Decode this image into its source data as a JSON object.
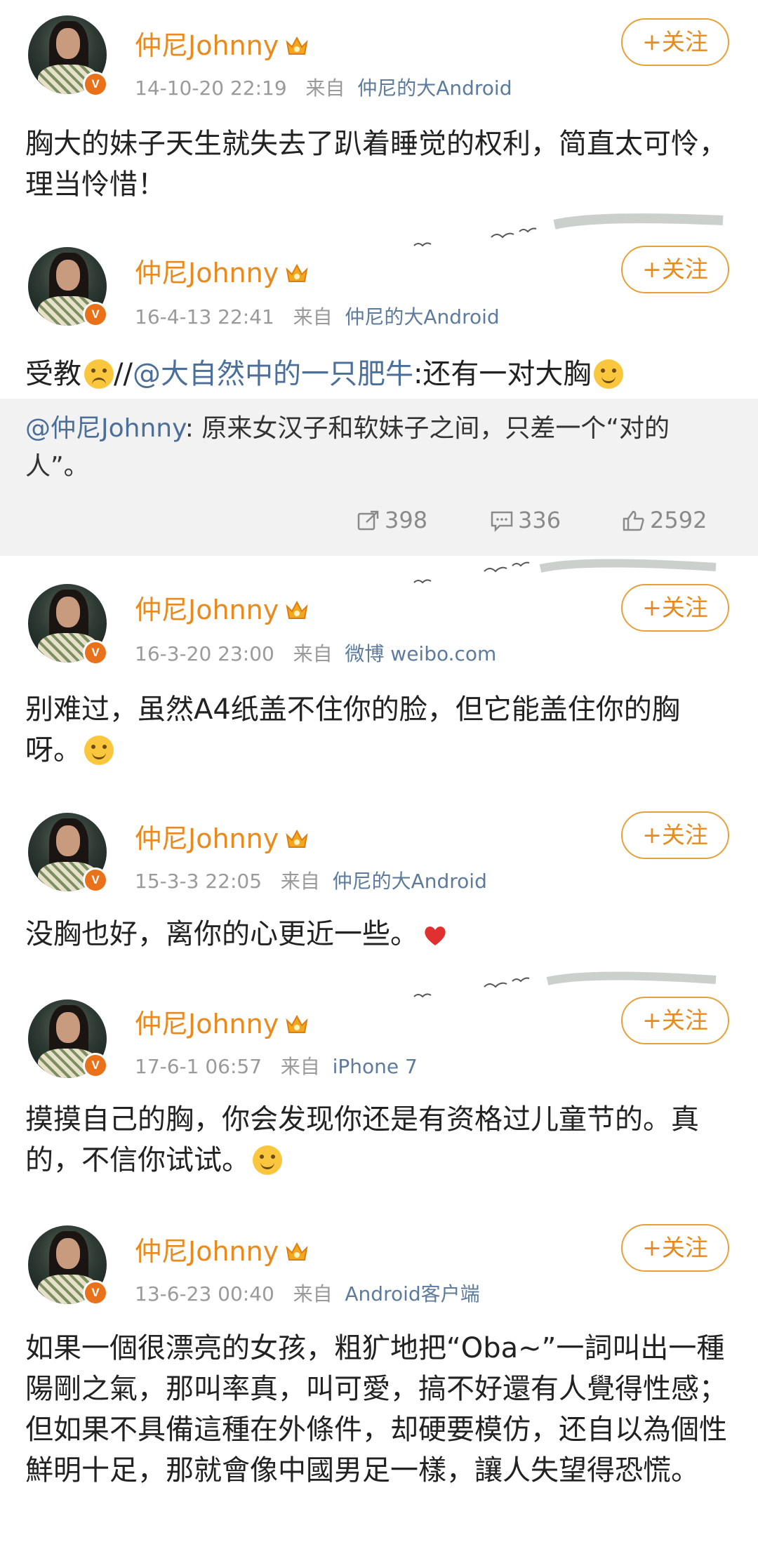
{
  "user": {
    "name": "仲尼Johnny",
    "follow_label": "+关注",
    "avatar_badge": "V"
  },
  "source_prefix": "来自",
  "posts": [
    {
      "time": "14-10-20 22:19",
      "source": "仲尼的大Android",
      "text": "胸大的妹子天生就失去了趴着睡觉的权利，简直太可怜，理当怜惜！"
    },
    {
      "time": "16-4-13 22:41",
      "source": "仲尼的大Android",
      "text_prefix": "受教",
      "text_sep": "//",
      "mention": "@大自然中的一只肥牛",
      "text_suffix": ":还有一对大胸",
      "repost": {
        "mention": "@仲尼Johnny",
        "text": ": 原来女汉子和软妹子之间，只差一个“对的人”。"
      },
      "stats": {
        "reposts": "398",
        "comments": "336",
        "likes": "2592"
      }
    },
    {
      "time": "16-3-20 23:00",
      "source": "微博 weibo.com",
      "text": "别难过，虽然A4纸盖不住你的脸，但它能盖住你的胸呀。"
    },
    {
      "time": "15-3-3 22:05",
      "source": "仲尼的大Android",
      "text": "没胸也好，离你的心更近一些。"
    },
    {
      "time": "17-6-1 06:57",
      "source": "iPhone 7",
      "text": "摸摸自己的胸，你会发现你还是有资格过儿童节的。真的，不信你试试。"
    },
    {
      "time": "13-6-23 00:40",
      "source": "Android客户端",
      "text": "如果一個很漂亮的女孩，粗犷地把“Oba~”一詞叫出一種陽剛之氣，那叫率真，叫可愛，搞不好還有人覺得性感；但如果不具備這種在外條件，却硬要模仿，还自以為個性鮮明十足，那就會像中國男足一樣，讓人失望得恐慌。"
    }
  ],
  "colors": {
    "name": "#e98a1e",
    "link": "#4b6f9a",
    "meta": "#9a9a9a",
    "follow_border": "#e8a03a",
    "repost_bg": "#f2f2f2"
  },
  "icons": [
    "crown-badge-icon",
    "verified-v-icon",
    "repost-icon",
    "comment-icon",
    "like-icon",
    "smile-emoji-icon",
    "sad-emoji-icon",
    "heart-icon"
  ]
}
